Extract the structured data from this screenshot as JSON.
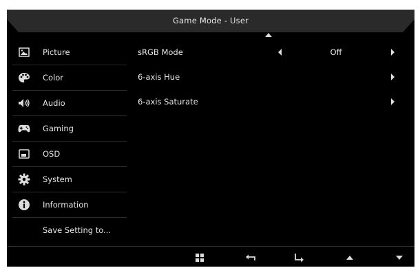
{
  "header": {
    "title": "Game Mode - User"
  },
  "sidebar": {
    "items": [
      {
        "label": "Picture",
        "icon": "picture-icon"
      },
      {
        "label": "Color",
        "icon": "palette-icon"
      },
      {
        "label": "Audio",
        "icon": "speaker-icon"
      },
      {
        "label": "Gaming",
        "icon": "gamepad-icon"
      },
      {
        "label": "OSD",
        "icon": "osd-window-icon"
      },
      {
        "label": "System",
        "icon": "gear-icon"
      },
      {
        "label": "Information",
        "icon": "info-icon"
      },
      {
        "label": "Save Setting to..."
      }
    ]
  },
  "main": {
    "rows": [
      {
        "label": "sRGB Mode",
        "value": "Off"
      },
      {
        "label": "6-axis Hue"
      },
      {
        "label": "6-axis Saturate"
      }
    ]
  },
  "footer": {
    "buttons": [
      "menu-grid-icon",
      "back-icon",
      "enter-icon",
      "up-arrow-icon",
      "down-arrow-icon"
    ]
  },
  "colors": {
    "background": "#000000",
    "titlebar": "#232323",
    "text": "#e6e6e6"
  }
}
